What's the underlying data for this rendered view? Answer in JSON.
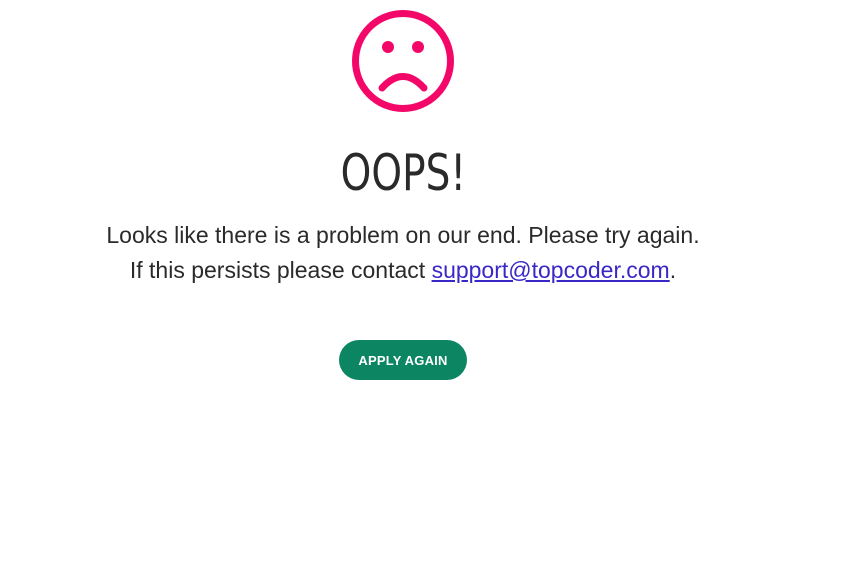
{
  "error": {
    "icon": "sad-face-icon",
    "icon_color": "#f30869",
    "title": "OOPS!",
    "line1": "Looks like there is a problem on our end. Please try again.",
    "line2_prefix": "If this persists please contact ",
    "support_email": "support@topcoder.com",
    "line2_suffix": "."
  },
  "actions": {
    "apply_again_label": "APPLY AGAIN",
    "button_color": "#0b8562"
  }
}
